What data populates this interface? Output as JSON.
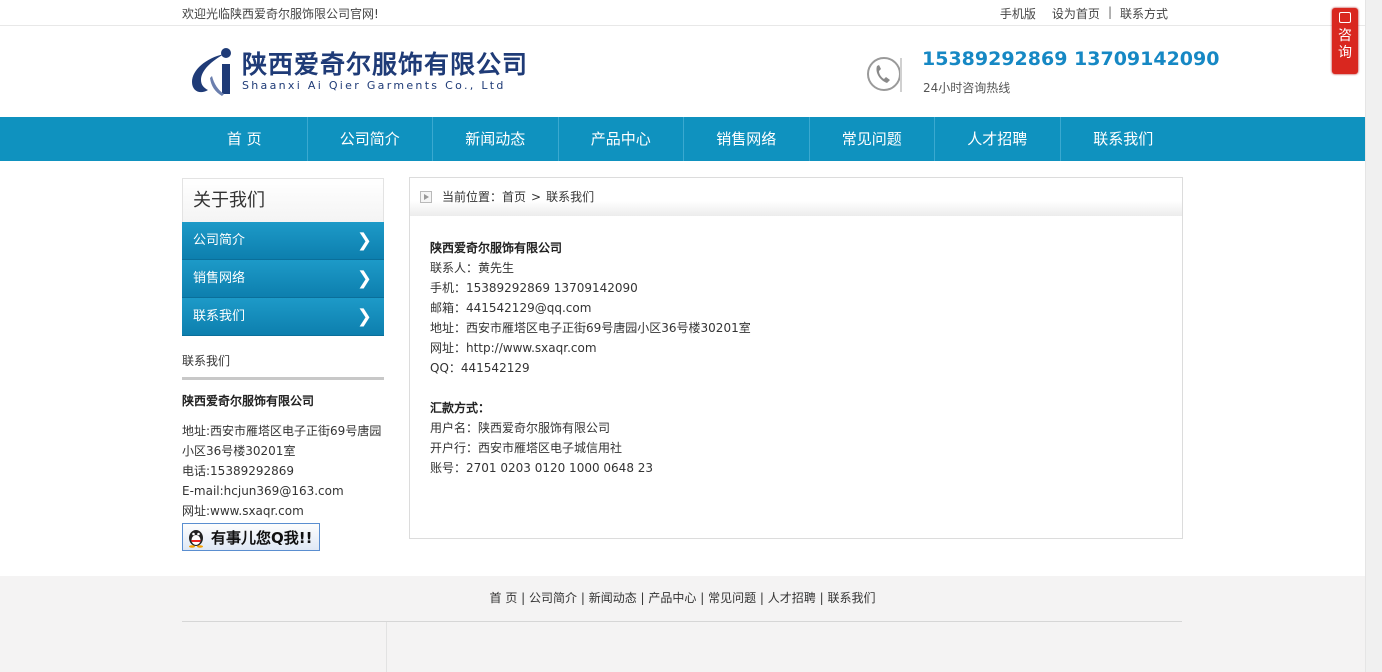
{
  "topbar": {
    "welcome": "欢迎光临陕西爱奇尔服饰限公司官网!",
    "links": [
      "手机版",
      "设为首页",
      "联系方式"
    ],
    "separator": "|"
  },
  "header": {
    "logo_cn": "陕西爱奇尔服饰有限公司",
    "logo_en": "Shaanxi Ai Qier Garments Co., Ltd",
    "hotline_numbers": "15389292869  13709142090",
    "hotline_label": "24小时咨询热线"
  },
  "nav": {
    "items": [
      "首 页",
      "公司简介",
      "新闻动态",
      "产品中心",
      "销售网络",
      "常见问题",
      "人才招聘",
      "联系我们"
    ]
  },
  "side": {
    "title": "关于我们",
    "menu": [
      "公司简介",
      "销售网络",
      "联系我们"
    ],
    "chevron": "❯",
    "contact_heading": "联系我们",
    "company": "陕西爱奇尔服饰有限公司",
    "lines": [
      "地址:西安市雁塔区电子正街69号唐园小区36号楼30201室",
      "电话:15389292869",
      "E-mail:hcjun369@163.com",
      "网址:www.sxaqr.com"
    ],
    "qq_button": "有事儿您Q我!!"
  },
  "main": {
    "crumb_prefix": "当前位置：",
    "crumb_home": "首页",
    "crumb_sep": ">",
    "crumb_current": "联系我们",
    "company": "陕西爱奇尔服饰有限公司",
    "lines": [
      "联系人：黄先生",
      "手机：15389292869 13709142090",
      "邮箱：441542129@qq.com",
      "地址：西安市雁塔区电子正街69号唐园小区36号楼30201室",
      "网址：http://www.sxaqr.com",
      "QQ：441542129"
    ],
    "remit_title": "汇款方式：",
    "remit_lines": [
      "用户名：陕西爱奇尔服饰有限公司",
      "开户行：西安市雁塔区电子城信用社",
      "账号：2701 0203 0120 1000 0648 23"
    ]
  },
  "footer": {
    "links": [
      "首 页",
      "公司简介",
      "新闻动态",
      "产品中心",
      "常见问题",
      "人才招聘",
      "联系我们"
    ]
  },
  "consult": {
    "label": "咨询"
  },
  "colors": {
    "nav": "#0f92bf",
    "hotline": "#1688c4",
    "logo": "#1f3b77",
    "consult": "#d9271f"
  }
}
